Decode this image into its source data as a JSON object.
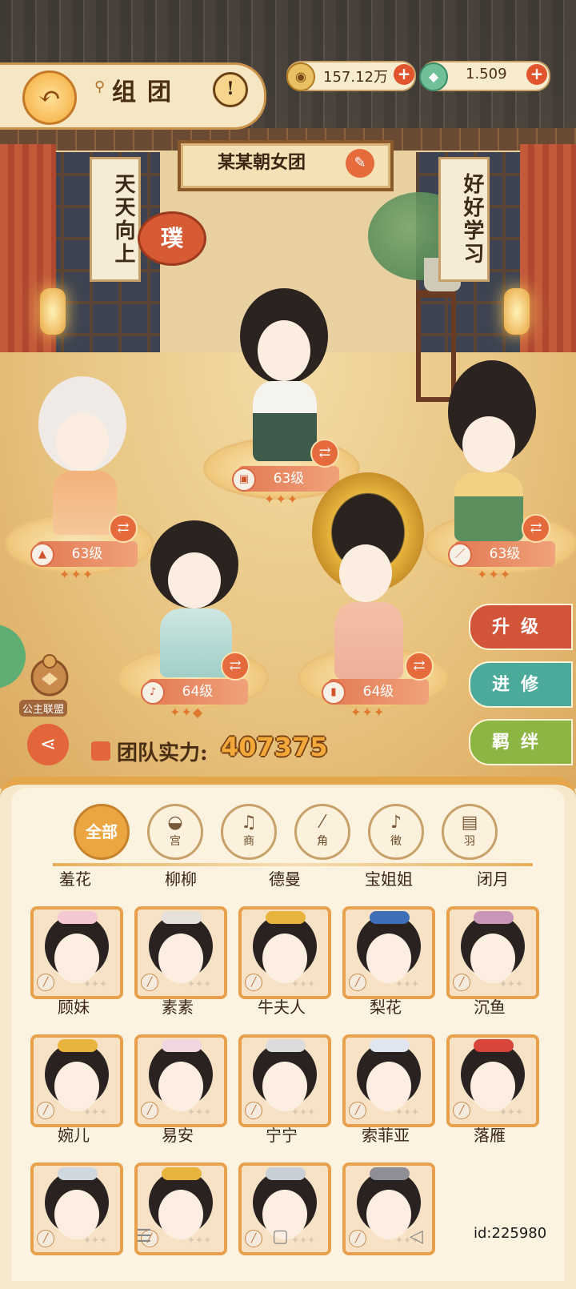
{
  "header": {
    "title": "组团",
    "back_icon": "back-arrow-icon",
    "info_icon": "exclamation-icon"
  },
  "resources": {
    "coins": "157.12万",
    "jade": "1.509"
  },
  "team": {
    "name": "某某朝女团",
    "power_label": "团队实力:",
    "power_value": "407375"
  },
  "decor": {
    "left_scroll": "天天向上",
    "right_scroll": "好好学习",
    "seal": "璞"
  },
  "formation": [
    {
      "level": "63级",
      "stars": "✦✦✦"
    },
    {
      "level": "63级",
      "stars": "✦✦✦"
    },
    {
      "level": "63级",
      "stars": "✦✦✦"
    },
    {
      "level": "64级",
      "stars": "✦✦◆"
    },
    {
      "level": "64级",
      "stars": "✦✦✦"
    }
  ],
  "side_actions": {
    "upgrade": "升级",
    "advance": "进修",
    "bond": "羁绊"
  },
  "alliance_label": "公主联盟",
  "filters": [
    {
      "label": "全部"
    },
    {
      "label": "宫"
    },
    {
      "label": "商"
    },
    {
      "label": "角"
    },
    {
      "label": "徵"
    },
    {
      "label": "羽"
    }
  ],
  "formation_names": [
    "羞花",
    "柳柳",
    "德曼",
    "宝姐姐",
    "闭月"
  ],
  "roster": [
    {
      "name": "顾妹"
    },
    {
      "name": "素素"
    },
    {
      "name": "牛夫人"
    },
    {
      "name": "梨花"
    },
    {
      "name": "沉鱼"
    },
    {
      "name": "婉儿"
    },
    {
      "name": "易安"
    },
    {
      "name": "宁宁"
    },
    {
      "name": "索菲亚"
    },
    {
      "name": "落雁"
    },
    {
      "name": ""
    },
    {
      "name": ""
    },
    {
      "name": ""
    },
    {
      "name": ""
    }
  ],
  "footer": {
    "uid": "id:225980"
  },
  "colors": {
    "accent": "#e56a3c",
    "gold": "#eba642",
    "upgrade": "#d2553a",
    "advance": "#4caa9a",
    "bond": "#8cb544"
  }
}
